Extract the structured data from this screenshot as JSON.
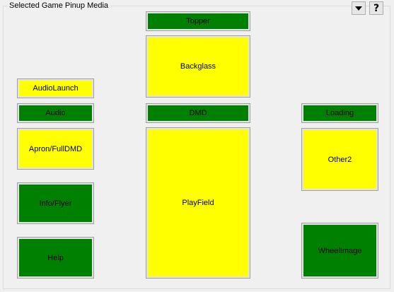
{
  "group": {
    "title": "Selected Game Pinup Media"
  },
  "toolbar": {
    "dropdown_icon": "triangle-down-icon",
    "help_label": "?"
  },
  "colors": {
    "active": "#008000",
    "inactive": "#ffff00"
  },
  "tiles": {
    "topper": {
      "label": "Topper",
      "state": "green"
    },
    "backglass": {
      "label": "Backglass",
      "state": "yellow"
    },
    "audiolaunch": {
      "label": "AudioLaunch",
      "state": "yellow"
    },
    "audio": {
      "label": "Audio",
      "state": "green"
    },
    "dmd": {
      "label": "DMD",
      "state": "green"
    },
    "loading": {
      "label": "Loading",
      "state": "green"
    },
    "apron": {
      "label": "Apron/FullDMD",
      "state": "yellow"
    },
    "playfield": {
      "label": "PlayField",
      "state": "yellow"
    },
    "other2": {
      "label": "Other2",
      "state": "yellow"
    },
    "infoflyer": {
      "label": "Info/Flyer",
      "state": "green"
    },
    "help": {
      "label": "Help",
      "state": "green"
    },
    "wheelimage": {
      "label": "WheelImage",
      "state": "green"
    }
  }
}
